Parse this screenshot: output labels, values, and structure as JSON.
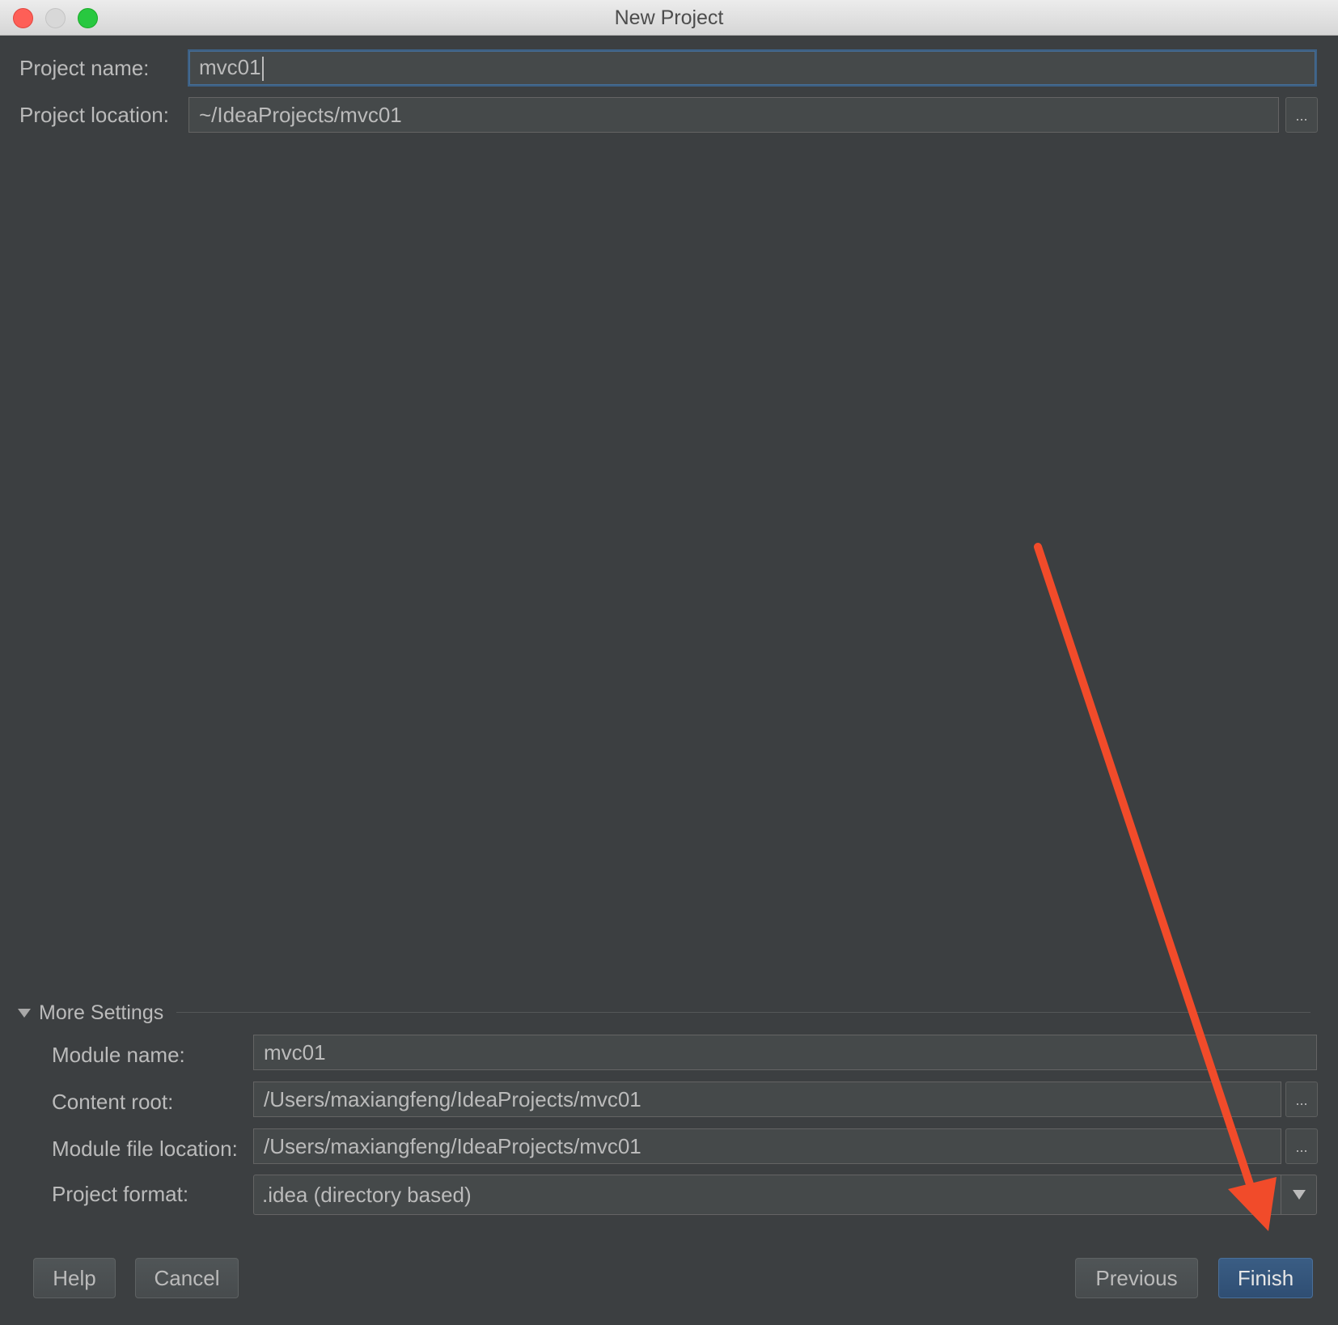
{
  "window": {
    "title": "New Project"
  },
  "form": {
    "project_name": {
      "label": "Project name:",
      "value": "mvc01"
    },
    "project_location": {
      "label": "Project location:",
      "value": "~/IdeaProjects/mvc01",
      "browse": "..."
    }
  },
  "more_settings": {
    "header": "More Settings",
    "module_name": {
      "label": "Module name:",
      "value": "mvc01"
    },
    "content_root": {
      "label": "Content root:",
      "value": "/Users/maxiangfeng/IdeaProjects/mvc01",
      "browse": "..."
    },
    "module_file_location": {
      "label": "Module file location:",
      "value": "/Users/maxiangfeng/IdeaProjects/mvc01",
      "browse": "..."
    },
    "project_format": {
      "label": "Project format:",
      "value": ".idea (directory based)"
    }
  },
  "buttons": {
    "help": "Help",
    "cancel": "Cancel",
    "previous": "Previous",
    "finish": "Finish"
  },
  "colors": {
    "background": "#3c3f41",
    "field": "#45494a",
    "text": "#bbbbbb",
    "accent": "#2f4e73",
    "annotation_arrow": "#f14b2a"
  },
  "icons": {
    "close": "traffic-close-icon",
    "minimize": "traffic-minimize-icon",
    "maximize": "traffic-maximize-icon",
    "section_toggle": "triangle-down-icon",
    "dropdown": "chevron-down-icon",
    "annotation": "arrow-annotation-icon"
  }
}
